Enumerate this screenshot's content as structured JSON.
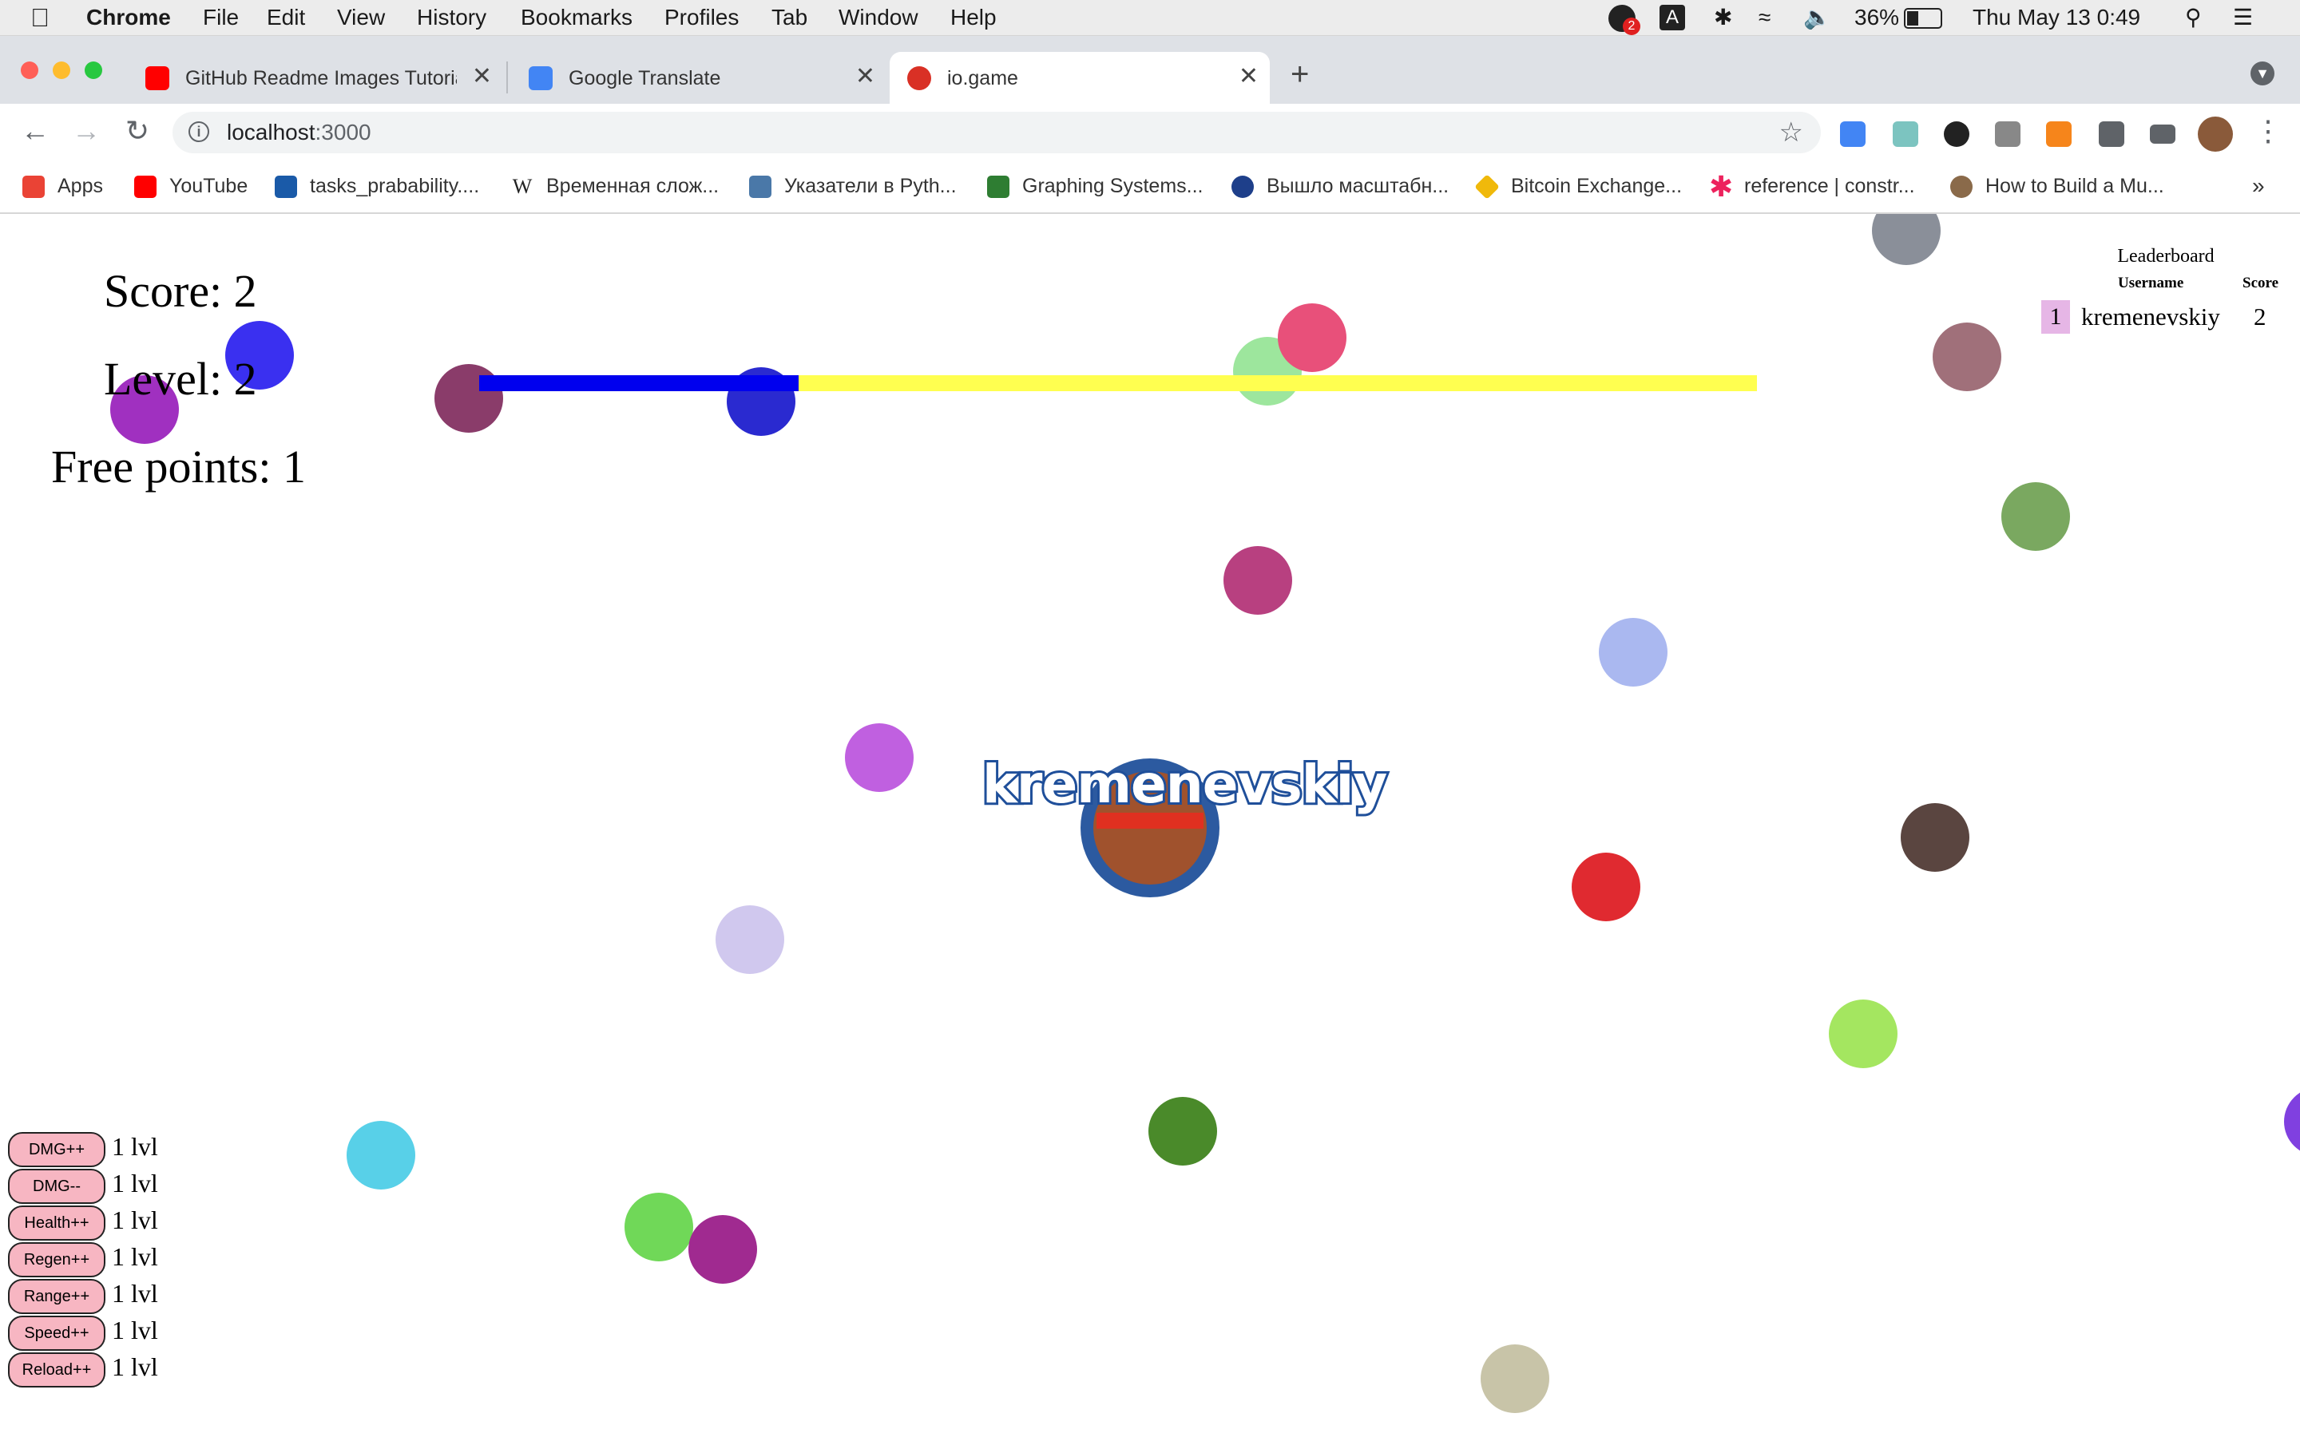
{
  "menubar": {
    "app": "Chrome",
    "items": [
      "File",
      "Edit",
      "View",
      "History",
      "Bookmarks",
      "Profiles",
      "Tab",
      "Window",
      "Help"
    ],
    "notification_count": "2",
    "input_source": "A",
    "battery": "36%",
    "datetime": "Thu May 13  0:49"
  },
  "tabs": [
    {
      "title": "GitHub Readme Images Tutoria",
      "icon": "youtube-icon",
      "icon_color": "#ff0000"
    },
    {
      "title": "Google Translate",
      "icon": "google-translate-icon",
      "icon_color": "#4285f4"
    },
    {
      "title": "io.game",
      "icon": "io-game-icon",
      "icon_color": "#d93025"
    }
  ],
  "address": {
    "host": "localhost",
    "port": ":3000"
  },
  "bookmarks": [
    {
      "label": "Apps",
      "icon": "apps-grid-icon",
      "color": "#ea4335"
    },
    {
      "label": "YouTube",
      "icon": "youtube-icon",
      "color": "#ff0000"
    },
    {
      "label": "tasks_prabability....",
      "icon": "hse-icon",
      "color": "#1a5aa8"
    },
    {
      "label": "Временная слож...",
      "icon": "wikipedia-icon",
      "color": "#222222"
    },
    {
      "label": "Указатели в Pyth...",
      "icon": "habr-icon",
      "color": "#4a78a8"
    },
    {
      "label": "Graphing Systems...",
      "icon": "math-icon",
      "color": "#2e7d32"
    },
    {
      "label": "Вышло масштабн...",
      "icon": "globe-icon",
      "color": "#1e3f8a"
    },
    {
      "label": "Bitcoin Exchange...",
      "icon": "binance-icon",
      "color": "#f0b90b"
    },
    {
      "label": "reference | constr...",
      "icon": "p5-asterisk-icon",
      "color": "#ed225d"
    },
    {
      "label": "How to Build a Mu...",
      "icon": "profile-icon",
      "color": "#8a6a4a"
    }
  ],
  "game": {
    "score_label": "Score: 2",
    "level_label": "Level: 2",
    "free_points_label": "Free points: 1",
    "xp_progress": 0.25,
    "player_name": "kremenevskiy",
    "leaderboard": {
      "title": "Leaderboard",
      "col_username": "Username",
      "col_score": "Score",
      "rows": [
        {
          "rank": "1",
          "username": "kremenevskiy",
          "score": "2"
        }
      ]
    },
    "upgrades": [
      {
        "label": "DMG++",
        "level": "1 lvl"
      },
      {
        "label": "DMG--",
        "level": "1 lvl"
      },
      {
        "label": "Health++",
        "level": "1 lvl"
      },
      {
        "label": "Regen++",
        "level": "1 lvl"
      },
      {
        "label": "Range++",
        "level": "1 lvl"
      },
      {
        "label": "Speed++",
        "level": "1 lvl"
      },
      {
        "label": "Reload++",
        "level": "1 lvl"
      }
    ],
    "colors": {
      "xp_fill": "#0000ee",
      "xp_track": "#ffff50",
      "player_body": "#a0522d",
      "player_ring": "#2c5aa0",
      "health": "#e03020",
      "upgrade_button": "#f7b6c2"
    }
  }
}
